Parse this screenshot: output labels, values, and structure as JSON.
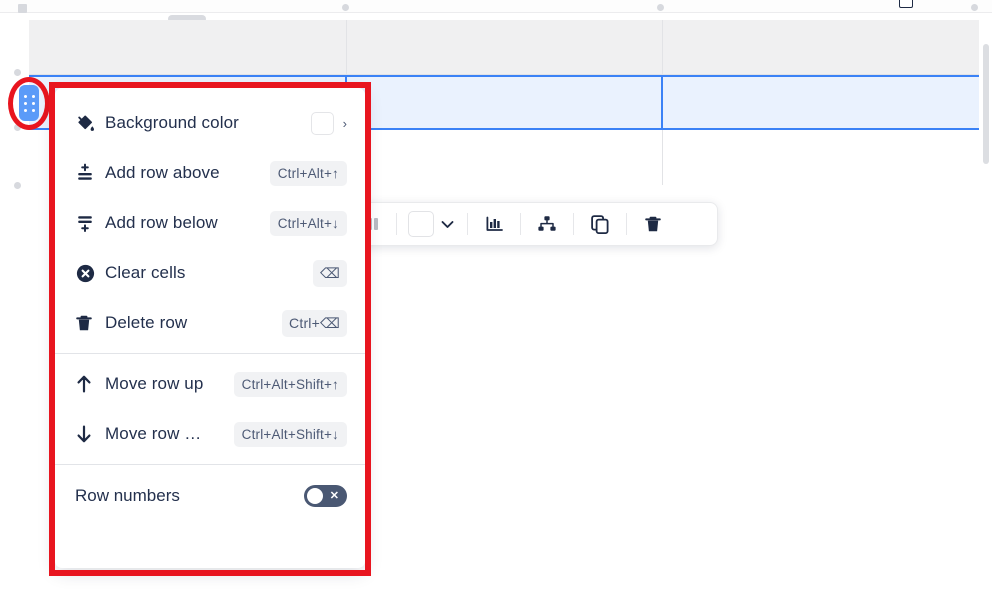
{
  "app": {
    "surface": "table-editor",
    "accent_color": "#3b82f6",
    "annotation_color": "#e8151f",
    "selected_row_fill": "#eaf2fe",
    "header_row_fill": "#f0f0f1",
    "menu_text_color": "#23304d"
  },
  "table": {
    "columns": 3,
    "rows": [
      {
        "type": "header",
        "cells": [
          "",
          "",
          ""
        ]
      },
      {
        "type": "selected",
        "cells": [
          "",
          "",
          ""
        ]
      },
      {
        "type": "normal",
        "cells": [
          "",
          "",
          ""
        ]
      }
    ],
    "row_grip": {
      "icon": "drag-grip-icon",
      "dots": 6
    }
  },
  "toolbar": {
    "items": [
      {
        "name": "columns-icon",
        "label": "",
        "icon": "columns-icon",
        "disabled": true
      },
      {
        "name": "color-swatch",
        "label": "",
        "icon": "color-swatch-icon",
        "color": "#ffffff"
      },
      {
        "name": "color-dropdown-chevron",
        "label": "",
        "icon": "chevron-down-icon"
      },
      {
        "name": "chart-icon",
        "label": "",
        "icon": "bar-chart-icon"
      },
      {
        "name": "hierarchy-icon",
        "label": "",
        "icon": "org-chart-icon"
      },
      {
        "name": "duplicate-icon",
        "label": "",
        "icon": "copy-icon"
      },
      {
        "name": "delete-icon",
        "label": "",
        "icon": "trash-icon"
      }
    ]
  },
  "context_menu": {
    "groups": [
      {
        "items": [
          {
            "icon": "paint-bucket-icon",
            "label": "Background color",
            "shortcut": "",
            "has_swatch": true,
            "swatch_color": "#ffffff",
            "caret": "›"
          },
          {
            "icon": "add-row-above-icon",
            "label": "Add row above",
            "shortcut": "Ctrl+Alt+↑"
          },
          {
            "icon": "add-row-below-icon",
            "label": "Add row below",
            "shortcut": "Ctrl+Alt+↓"
          },
          {
            "icon": "clear-cells-icon",
            "label": "Clear cells",
            "shortcut": "⌫"
          },
          {
            "icon": "trash-icon",
            "label": "Delete row",
            "shortcut": "Ctrl+⌫"
          }
        ]
      },
      {
        "items": [
          {
            "icon": "arrow-up-icon",
            "label": "Move row up",
            "shortcut": "Ctrl+Alt+Shift+↑"
          },
          {
            "icon": "arrow-down-icon",
            "label": "Move row …",
            "shortcut": "Ctrl+Alt+Shift+↓"
          }
        ]
      }
    ],
    "toggle": {
      "label": "Row numbers",
      "state": "off",
      "state_glyph": "✕"
    }
  }
}
